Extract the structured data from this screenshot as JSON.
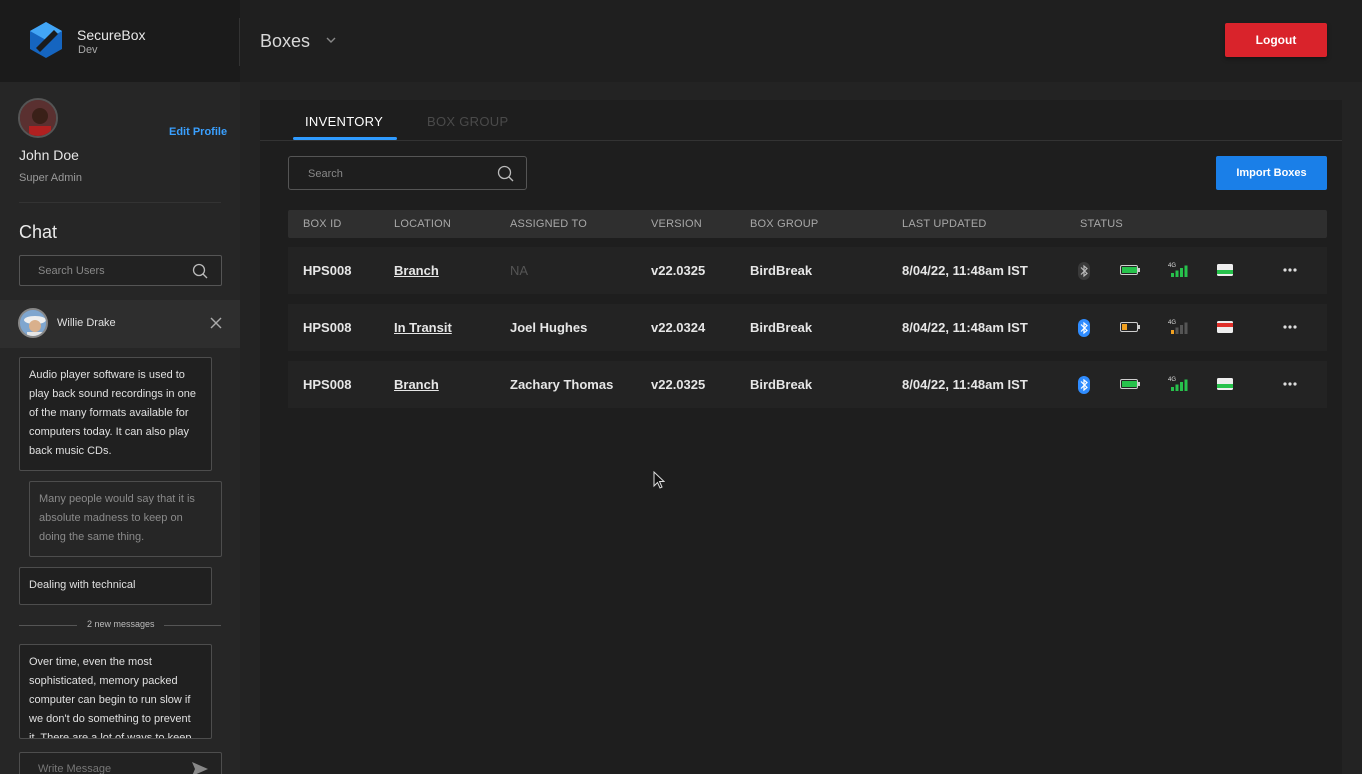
{
  "app": {
    "name": "SecureBox",
    "env": "Dev"
  },
  "header": {
    "title": "Boxes",
    "logout_label": "Logout"
  },
  "profile": {
    "name": "John Doe",
    "role": "Super Admin",
    "edit_label": "Edit Profile"
  },
  "chat": {
    "heading": "Chat",
    "search_placeholder": "Search Users",
    "active_user": "Willie Drake",
    "messages": [
      {
        "direction": "in",
        "text": "Audio player software is used to play back sound recordings in one of the many formats available for computers today. It can also play back music CDs."
      },
      {
        "direction": "out",
        "text": "Many people would say that it is absolute madness to keep on doing the same thing."
      },
      {
        "direction": "in",
        "text": "Dealing with technical"
      },
      {
        "direction": "in",
        "text": "Over time, even the most sophisticated, memory packed computer can begin to run slow if we don't do something to prevent it. There are a lot of ways to keep"
      }
    ],
    "new_messages_label": "2 new messages",
    "write_placeholder": "Write Message"
  },
  "tabs": [
    {
      "label": "INVENTORY",
      "active": true
    },
    {
      "label": "BOX GROUP",
      "active": false
    }
  ],
  "inventory": {
    "search_placeholder": "Search",
    "import_label": "Import Boxes",
    "columns": [
      "BOX ID",
      "LOCATION",
      "ASSIGNED TO",
      "VERSION",
      "BOX GROUP",
      "LAST UPDATED",
      "STATUS"
    ],
    "rows": [
      {
        "box_id": "HPS008",
        "location": "Branch",
        "assigned_to": "NA",
        "version": "v22.0325",
        "box_group": "BirdBreak",
        "last_updated": "8/04/22, 11:48am IST",
        "status": {
          "bluetooth": "off",
          "battery_level": 1.0,
          "battery_color": "#27c24c",
          "signal": "4G",
          "signal_bars": 4,
          "flag": "green"
        }
      },
      {
        "box_id": "HPS008",
        "location": "In Transit",
        "assigned_to": "Joel Hughes",
        "version": "v22.0324",
        "box_group": "BirdBreak",
        "last_updated": "8/04/22, 11:48am IST",
        "status": {
          "bluetooth": "on",
          "battery_level": 0.3,
          "battery_color": "#f0a020",
          "signal": "4G",
          "signal_bars": 1,
          "flag": "red"
        }
      },
      {
        "box_id": "HPS008",
        "location": "Branch",
        "assigned_to": "Zachary Thomas",
        "version": "v22.0325",
        "box_group": "BirdBreak",
        "last_updated": "8/04/22, 11:48am IST",
        "status": {
          "bluetooth": "on",
          "battery_level": 1.0,
          "battery_color": "#27c24c",
          "signal": "4G",
          "signal_bars": 4,
          "flag": "green"
        }
      }
    ]
  },
  "colors": {
    "accent": "#2f9bff",
    "danger": "#d9232b",
    "primary_button": "#1a7fe8",
    "bluetooth_on": "#2f8cff"
  }
}
